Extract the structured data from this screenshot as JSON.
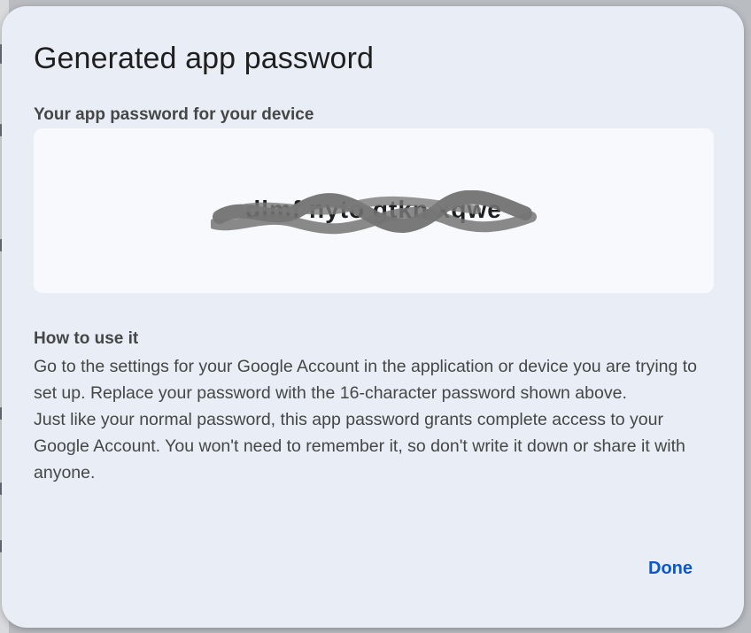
{
  "dialog": {
    "title": "Generated app password",
    "subtitle": "Your app password for your device",
    "password": "dlmf nyto gtkn xqwe",
    "how_to": {
      "heading": "How to use it",
      "paragraph1": "Go to the settings for your Google Account in the application or device you are trying to set up. Replace your password with the 16-character password shown above.",
      "paragraph2": "Just like your normal password, this app password grants complete access to your Google Account. You won't need to remember it, so don't write it down or share it with anyone."
    },
    "done_label": "Done"
  },
  "colors": {
    "dialog_bg": "#e9eef6",
    "password_box_bg": "#f8f9fd",
    "accent": "#0b57d0",
    "text_primary": "#1f1f1f",
    "text_secondary": "#444746",
    "redaction": "#6e6e6e"
  }
}
